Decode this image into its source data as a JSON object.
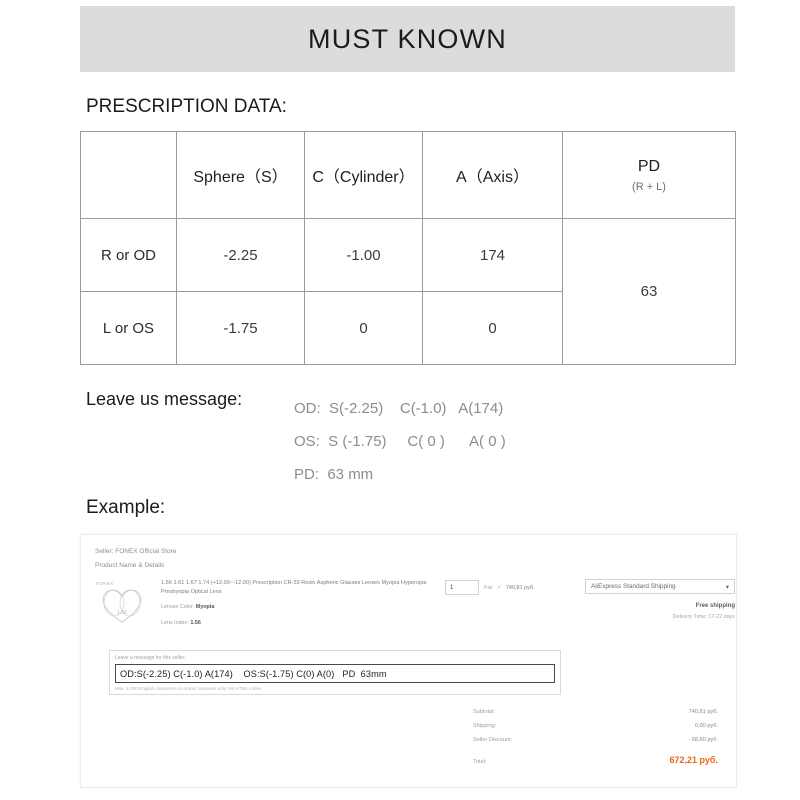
{
  "banner": {
    "title": "MUST KNOWN"
  },
  "sections": {
    "prescription_title": "PRESCRIPTION DATA:",
    "example_title": "Example:",
    "leave_label": "Leave us message:"
  },
  "table": {
    "headers": [
      "",
      "Sphere（S）",
      "C（Cylinder）",
      "A（Axis）",
      "PD"
    ],
    "pd_sub": "(R + L)",
    "rows": [
      {
        "label": "R or OD",
        "sphere": "-2.25",
        "cylinder": "-1.00",
        "axis": "174"
      },
      {
        "label": "L or OS",
        "sphere": "-1.75",
        "cylinder": "0",
        "axis": "0"
      }
    ],
    "pd_value": "63"
  },
  "message": {
    "line1": "OD:  S(-2.25)    C(-1.0)   A(174)",
    "line2": "OS:  S (-1.75)     C( 0 )      A( 0 )",
    "line3": "PD:  63 mm"
  },
  "example": {
    "seller": "Seller: FONEX Official Store",
    "product_header": "Product Name & Details",
    "brand": "FONEX",
    "product_title": "1.56 1.61 1.67 1.74 (+12.00~-12.00) Prescription CR-39 Resin Aspheric Glasses Lenses Myopia Hyperopia Presbyopia Optical Lens",
    "lenses_color_label": "Lenses Color:",
    "lenses_color_value": "Myopia",
    "lens_index_label": "Lens Index:",
    "lens_index_value": "1.56",
    "qty_value": "1",
    "qty_unit": "Pair",
    "qty_times": "×",
    "qty_price": "740,81 руб.",
    "shipping_option": "AliExpress Standard Shipping",
    "shipping_caret": "▾",
    "free_shipping": "Free shipping",
    "delivery_time": "Delivery Time: 17-22 days",
    "msgbox_label": "Leave a message for this seller:",
    "msgbox_value": "OD:S(-2.25) C(-1.0) A(174)    OS:S(-1.75) C(0) A(0)   PD  63mm",
    "msgbox_hint": "Max. 1,000 English characters or Arabic numerals only. No HTML codes.",
    "summary": [
      {
        "label": "Subtotal:",
        "value": "740,81 руб."
      },
      {
        "label": "Shipping:",
        "value": "0,00 руб."
      },
      {
        "label": "Seller Discount:",
        "value": "- 68,60 руб."
      }
    ],
    "total_label": "Total:",
    "total_value": "672,21 руб.",
    "total_color": "#ec6516"
  }
}
